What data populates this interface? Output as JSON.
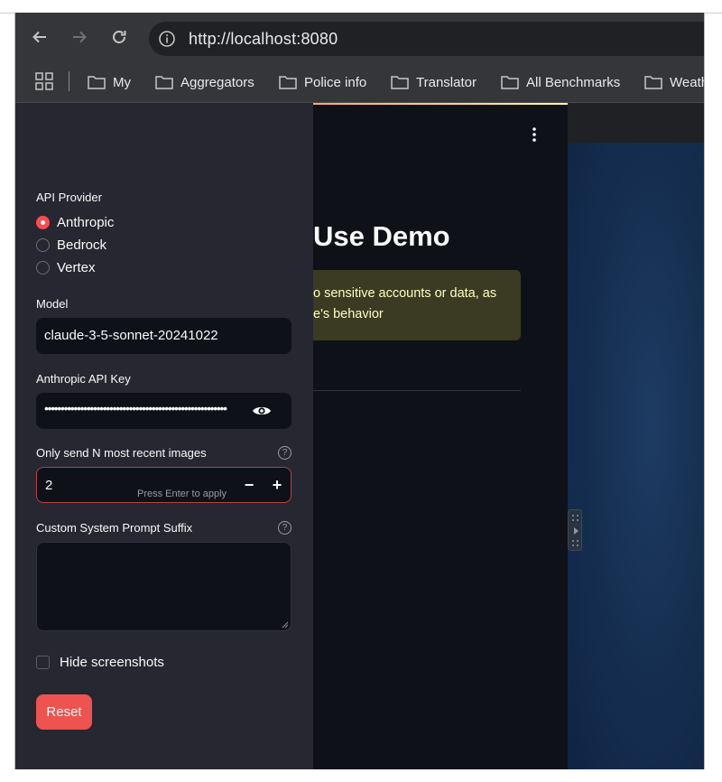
{
  "browser": {
    "url": "http://localhost:8080",
    "bookmarks": [
      "My",
      "Aggregators",
      "Police info",
      "Translator",
      "All Benchmarks",
      "Weath"
    ]
  },
  "main": {
    "title": "Use Demo",
    "warning_line1": "o sensitive accounts or data, as",
    "warning_line2": "e's behavior"
  },
  "sidebar": {
    "provider_label": "API Provider",
    "providers": [
      {
        "label": "Anthropic",
        "selected": true
      },
      {
        "label": "Bedrock",
        "selected": false
      },
      {
        "label": "Vertex",
        "selected": false
      }
    ],
    "model_label": "Model",
    "model_value": "claude-3-5-sonnet-20241022",
    "api_key_label": "Anthropic API Key",
    "api_key_value": "••••••••••••••••••••••••••••••••••••••••••••••••••••••••",
    "images_label": "Only send N most recent images",
    "images_value": "2",
    "images_hint": "Press Enter to apply",
    "decrement": "−",
    "increment": "+",
    "help_glyph": "?",
    "suffix_label": "Custom System Prompt Suffix",
    "hide_screenshots_label": "Hide screenshots",
    "reset_label": "Reset"
  },
  "colors": {
    "accent": "#ff4b4b",
    "sidebar_bg": "#262730",
    "app_bg": "#0e1117"
  }
}
